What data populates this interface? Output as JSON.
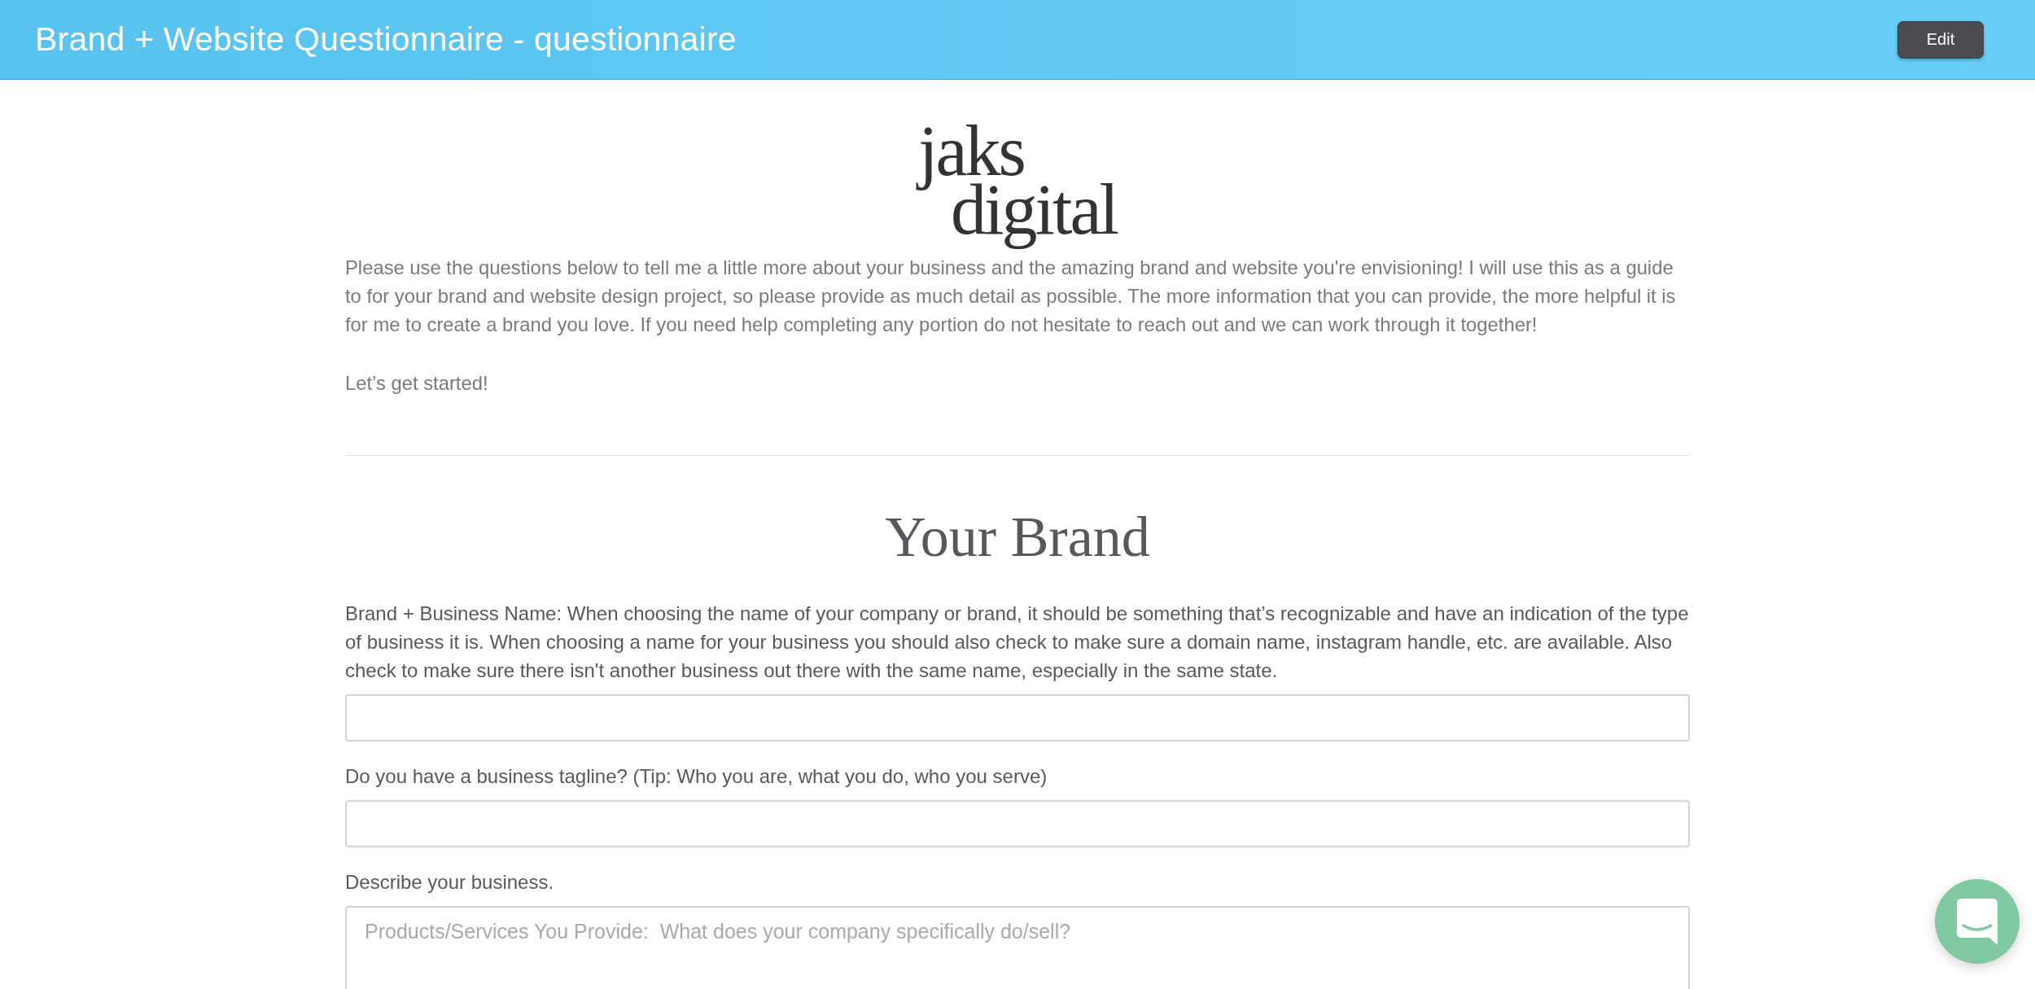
{
  "header": {
    "title": "Brand + Website Questionnaire - questionnaire",
    "edit_button": "Edit"
  },
  "logo": {
    "lines": [
      "jaks",
      "digital"
    ]
  },
  "intro": {
    "paragraphs": [
      "Please use the questions below to tell me a little more about your business and the amazing brand and website you're envisioning! I will use this as a guide to for your brand and website design project, so please provide as much detail as possible. The more information that you can provide, the more helpful it is for me to create a brand you love. If you need help completing any portion do not hesitate to reach out and we can work through it together!",
      "Let’s get started!"
    ]
  },
  "section": {
    "heading": "Your Brand",
    "questions": [
      {
        "kind": "input",
        "label": "Brand + Business Name: When choosing the name of your company or brand, it should be something that’s recognizable and have an indication of the type of business it is. When choosing a name for your business you should also check to make sure a domain name, instagram handle, etc. are available. Also check to make sure there isn't another business out there with the same name, especially in the same state."
      },
      {
        "kind": "input",
        "label": "Do you have a business tagline? (Tip: Who you are, what you do, who you serve)"
      },
      {
        "kind": "textarea",
        "label": "Describe your business.",
        "placeholder": "Products/Services You Provide:  What does your company specifically do/sell?"
      }
    ]
  }
}
